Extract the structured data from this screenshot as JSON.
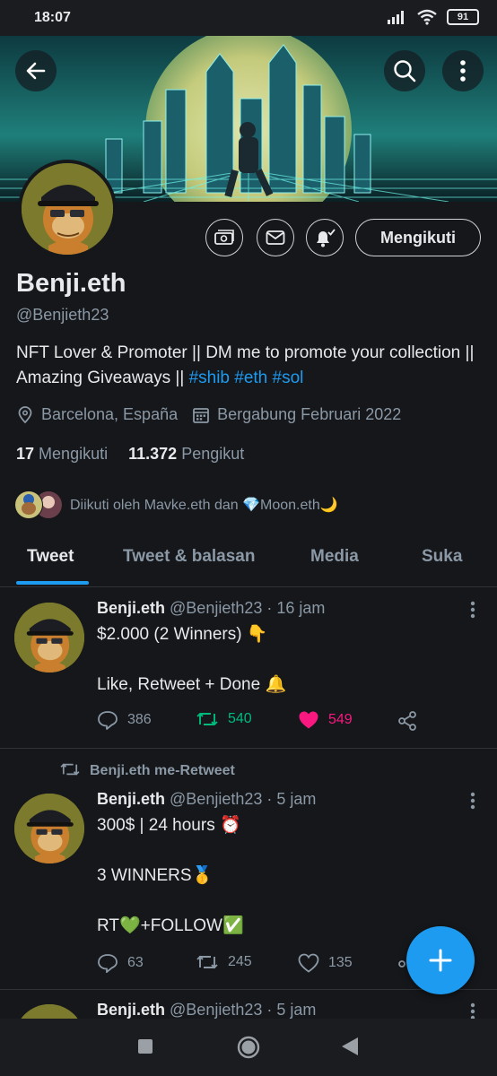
{
  "status": {
    "time": "18:07",
    "battery": "91"
  },
  "profile": {
    "follow_label": "Mengikuti",
    "name": "Benji.eth",
    "handle": "@Benjieth23",
    "bio_text": "NFT Lover & Promoter || DM me to promote your collection || Amazing Giveaways || ",
    "bio_tags": "#shib #eth #sol",
    "location": "Barcelona, España",
    "joined": "Bergabung Februari 2022",
    "following_count": "17",
    "following_label": "Mengikuti",
    "followers_count": "11.372",
    "followers_label": "Pengikut",
    "followed_by": "Diikuti oleh Mavke.eth dan 💎Moon.eth🌙"
  },
  "tabs": [
    "Tweet",
    "Tweet & balasan",
    "Media",
    "Suka"
  ],
  "tweets": [
    {
      "name": "Benji.eth",
      "meta": "@Benjieth23 · 16 jam",
      "text": "$2.000 (2 Winners) 👇\n\nLike, Retweet + Done 🔔",
      "replies": "386",
      "retweets": "540",
      "likes": "549"
    },
    {
      "retweet_label": "Benji.eth me-Retweet",
      "name": "Benji.eth",
      "meta": "@Benjieth23 · 5 jam",
      "text": "300$ | 24 hours ⏰\n\n3 WINNERS🥇\n\nRT💚+FOLLOW✅",
      "replies": "63",
      "retweets": "245",
      "likes": "135"
    },
    {
      "name": "Benji.eth",
      "meta": "@Benjieth23 · 5 jam"
    }
  ],
  "colors": {
    "accent": "#1d9bf0",
    "retweet": "#00ba7c",
    "like": "#f91880",
    "background": "#15171a"
  }
}
